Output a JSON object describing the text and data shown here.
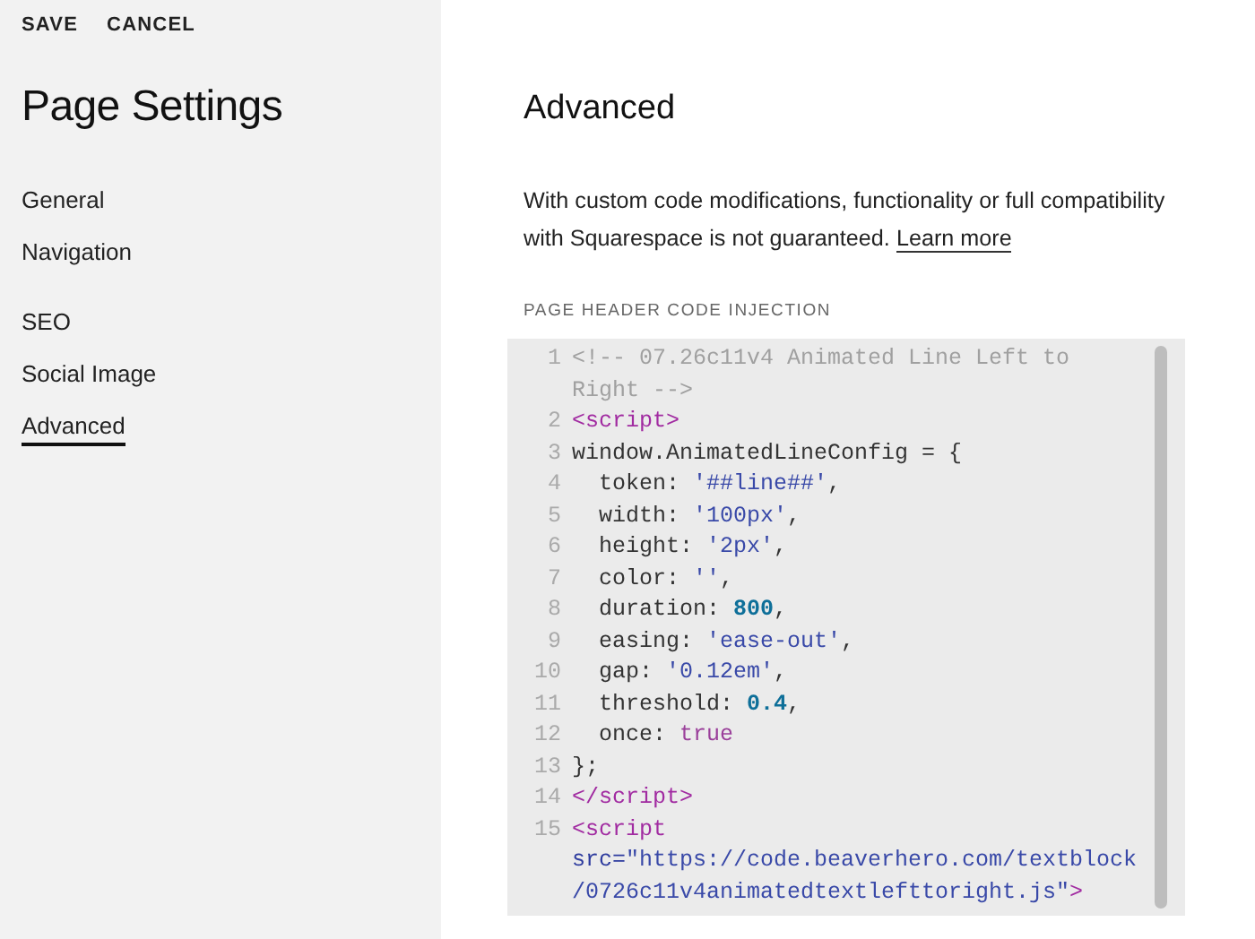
{
  "toolbar": [
    {
      "label": "SAVE"
    },
    {
      "label": "CANCEL"
    }
  ],
  "sidebar": {
    "title": "Page Settings",
    "groups": [
      {
        "items": [
          {
            "label": "General",
            "selected": false
          },
          {
            "label": "Navigation",
            "selected": false
          }
        ]
      },
      {
        "items": [
          {
            "label": "SEO",
            "selected": false
          },
          {
            "label": "Social Image",
            "selected": false
          },
          {
            "label": "Advanced",
            "selected": true
          }
        ]
      }
    ]
  },
  "main": {
    "title": "Advanced",
    "description": "With custom code modifications, functionality or full compatibility with Squarespace is not guaranteed.",
    "link": "Learn more",
    "code_injection": {
      "label": "PAGE HEADER CODE INJECTION",
      "lines": [
        {
          "number": "1",
          "rows": [
            [
              {
                "kind": "comment",
                "text": "<!-- 07.26c11v4 Animated Line Left to"
              }
            ],
            [
              {
                "kind": "comment",
                "text": "Right -->"
              }
            ]
          ]
        },
        {
          "number": "2",
          "rows": [
            [
              {
                "kind": "tag",
                "text": "<script>"
              }
            ]
          ]
        },
        {
          "number": "3",
          "rows": [
            [
              {
                "kind": "plain",
                "text": "window.AnimatedLineConfig = {"
              }
            ]
          ]
        },
        {
          "number": "4",
          "rows": [
            [
              {
                "kind": "plain",
                "text": "  token: "
              },
              {
                "kind": "string",
                "text": "'##line##'"
              },
              {
                "kind": "plain",
                "text": ","
              }
            ]
          ]
        },
        {
          "number": "5",
          "rows": [
            [
              {
                "kind": "plain",
                "text": "  width: "
              },
              {
                "kind": "string",
                "text": "'100px'"
              },
              {
                "kind": "plain",
                "text": ","
              }
            ]
          ]
        },
        {
          "number": "6",
          "rows": [
            [
              {
                "kind": "plain",
                "text": "  height: "
              },
              {
                "kind": "string",
                "text": "'2px'"
              },
              {
                "kind": "plain",
                "text": ","
              }
            ]
          ]
        },
        {
          "number": "7",
          "rows": [
            [
              {
                "kind": "plain",
                "text": "  color: "
              },
              {
                "kind": "string",
                "text": "''"
              },
              {
                "kind": "plain",
                "text": ","
              }
            ]
          ]
        },
        {
          "number": "8",
          "rows": [
            [
              {
                "kind": "plain",
                "text": "  duration: "
              },
              {
                "kind": "number",
                "text": "800"
              },
              {
                "kind": "plain",
                "text": ","
              }
            ]
          ]
        },
        {
          "number": "9",
          "rows": [
            [
              {
                "kind": "plain",
                "text": "  easing: "
              },
              {
                "kind": "string",
                "text": "'ease-out'"
              },
              {
                "kind": "plain",
                "text": ","
              }
            ]
          ]
        },
        {
          "number": "10",
          "rows": [
            [
              {
                "kind": "plain",
                "text": "  gap: "
              },
              {
                "kind": "string",
                "text": "'0.12em'"
              },
              {
                "kind": "plain",
                "text": ","
              }
            ]
          ]
        },
        {
          "number": "11",
          "rows": [
            [
              {
                "kind": "plain",
                "text": "  threshold: "
              },
              {
                "kind": "number",
                "text": "0.4"
              },
              {
                "kind": "plain",
                "text": ","
              }
            ]
          ]
        },
        {
          "number": "12",
          "rows": [
            [
              {
                "kind": "plain",
                "text": "  once: "
              },
              {
                "kind": "keyword",
                "text": "true"
              }
            ]
          ]
        },
        {
          "number": "13",
          "rows": [
            [
              {
                "kind": "plain",
                "text": "};"
              }
            ]
          ]
        },
        {
          "number": "14",
          "rows": [
            [
              {
                "kind": "tag",
                "text": "</script>"
              }
            ]
          ]
        },
        {
          "number": "15",
          "rows": [
            [
              {
                "kind": "tag",
                "text": "<script"
              }
            ],
            [
              {
                "kind": "attr",
                "text": "src="
              },
              {
                "kind": "string",
                "text": "\"https://code.beaverhero.com/textblock"
              }
            ],
            [
              {
                "kind": "string",
                "text": "/0726c11v4animatedtextlefttoright.js\""
              },
              {
                "kind": "tag",
                "text": ">"
              }
            ]
          ]
        }
      ]
    }
  }
}
